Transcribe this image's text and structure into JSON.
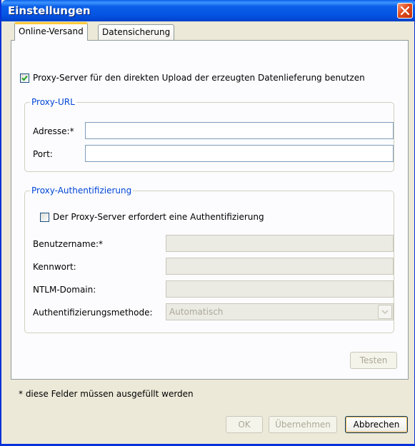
{
  "window": {
    "title": "Einstellungen"
  },
  "tabs": [
    {
      "label": "Online-Versand",
      "active": true
    },
    {
      "label": "Datensicherung",
      "active": false
    }
  ],
  "proxy_checkbox": {
    "label": "Proxy-Server für den direkten Upload der erzeugten Datenlieferung benutzen",
    "checked": true
  },
  "proxy_url": {
    "legend": "Proxy-URL",
    "address_label": "Adresse:*",
    "address_value": "",
    "port_label": "Port:",
    "port_value": ""
  },
  "proxy_auth": {
    "legend": "Proxy-Authentifizierung",
    "checkbox_label": "Der Proxy-Server erfordert eine Authentifizierung",
    "checkbox_checked": false,
    "username_label": "Benutzername:*",
    "username_value": "",
    "password_label": "Kennwort:",
    "password_value": "",
    "ntlm_label": "NTLM-Domain:",
    "ntlm_value": "",
    "method_label": "Authentifizierungsmethode:",
    "method_value": "Automatisch"
  },
  "buttons": {
    "test": "Testen",
    "ok": "OK",
    "apply": "Übernehmen",
    "cancel": "Abbrechen"
  },
  "footnote": "* diese Felder müssen ausgefüllt werden",
  "colors": {
    "titlebar": "#0554e3",
    "dialog_bg": "#ece9d8",
    "legend_text": "#0046d5",
    "close_button": "#e04a1c",
    "active_tab_accent": "#ffc83c"
  }
}
